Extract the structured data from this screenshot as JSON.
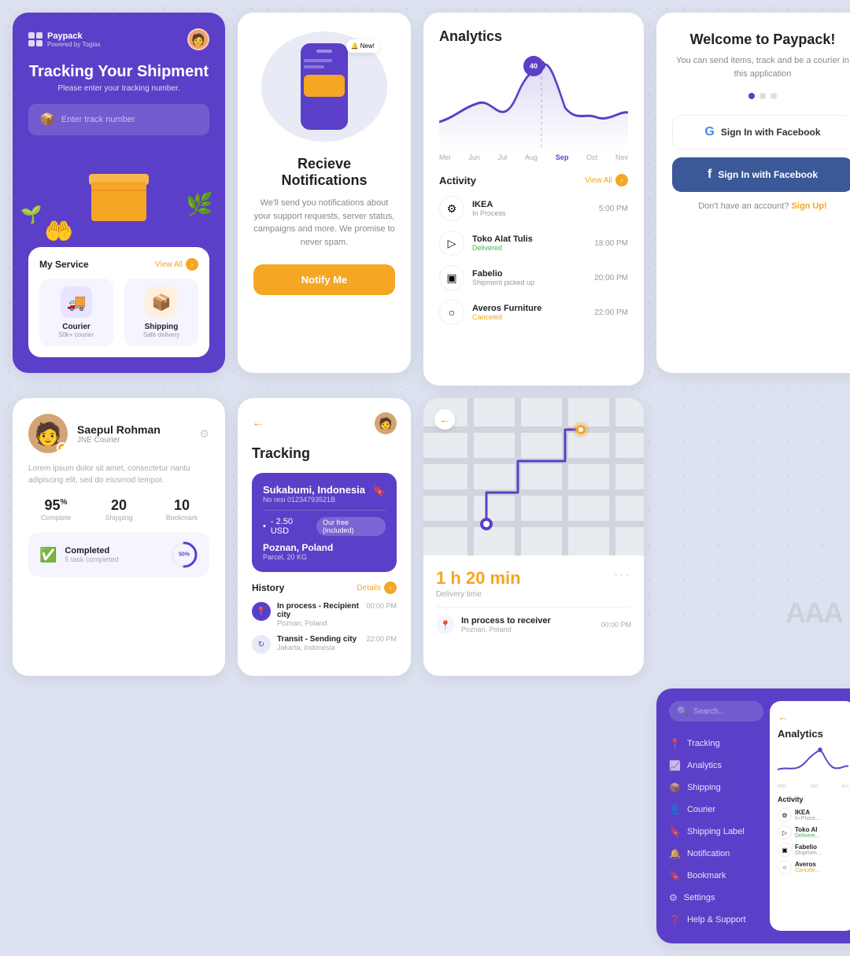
{
  "app": {
    "brand": "Paypack",
    "powered_by": "Powered by Togias"
  },
  "card_tracking": {
    "title": "Tracking Your Shipment",
    "subtitle": "Please enter your tracking number.",
    "input_placeholder": "Enter track number",
    "my_service_title": "My Service",
    "view_all": "View All",
    "service_courier_label": "Courier",
    "service_courier_sub": "50k+ courier",
    "service_shipping_label": "Shipping",
    "service_shipping_sub": "Safe delivery"
  },
  "card_notifications": {
    "title": "Recieve Notifications",
    "body": "We'll send you notifications about your support requests, server status, campaigns and more. We promise to never spam.",
    "button": "Notify Me"
  },
  "card_analytics": {
    "title": "Analytics",
    "chart_labels": [
      "Mei",
      "Jun",
      "Jul",
      "Aug",
      "Sep",
      "Oct",
      "Nov"
    ],
    "active_label": "Sep",
    "chart_peak": "40",
    "activity_title": "Activity",
    "view_all": "View All",
    "activities": [
      {
        "name": "IKEA",
        "status": "In Process",
        "status_class": "process",
        "time": "5:00 PM",
        "icon": "⚙"
      },
      {
        "name": "Toko Alat Tulis",
        "status": "Delivered",
        "status_class": "delivered",
        "time": "18:00 PM",
        "icon": "▷"
      },
      {
        "name": "Fabelio",
        "status": "Shipment picked up",
        "status_class": "pickup",
        "time": "20:00 PM",
        "icon": "▣"
      },
      {
        "name": "Averos Furniture",
        "status": "Canceled",
        "status_class": "canceled",
        "time": "22:00 PM",
        "icon": "○"
      }
    ]
  },
  "card_welcome": {
    "title": "Welcome to Paypack!",
    "body": "You can send items, track and be a courier in this application",
    "btn_google": "Sign In with Facebook",
    "btn_facebook": "Sign In with Facebook",
    "no_account": "Don't have an account?",
    "sign_up": "Sign Up!"
  },
  "card_profile": {
    "name": "Saepul Rohman",
    "sub": "JNE Courier",
    "desc": "Lorem ipsum dolor sit amet, consectetur nantu adipiscing elit, sed do eiusmod tempor.",
    "stat_complete_val": "95",
    "stat_complete_sup": "%",
    "stat_complete_label": "Complete",
    "stat_shipping_val": "20",
    "stat_shipping_label": "Shipping",
    "stat_bookmark_val": "10",
    "stat_bookmark_label": "Bookmark",
    "completed_label": "Completed",
    "completed_sub": "5 task completed",
    "progress_val": "50%"
  },
  "card_tracking_detail": {
    "title": "Tracking",
    "origin_city": "Sukabumi, Indonesia",
    "tracking_no": "No resi 01234793521B",
    "amount": "- 2.50 USD",
    "free_label": "Our free (included)",
    "dest_city": "Poznan, Poland",
    "dest_sub": "Parcel, 20 KG",
    "history_title": "History",
    "details": "Details",
    "history_items": [
      {
        "label": "In process - Recipient city",
        "city": "Poznan, Poland",
        "time": "00:00 PM"
      },
      {
        "label": "Transit - Sending city",
        "city": "Jakarta, Indonesia",
        "time": "22:00 PM"
      }
    ]
  },
  "card_map": {
    "delivery_time": "1 h 20 min",
    "delivery_label": "Delivery time",
    "in_process": "In process to receiver",
    "city": "Poznan, Poland",
    "time": "00:00 PM"
  },
  "sidebar": {
    "search_placeholder": "Search...",
    "menu_items": [
      {
        "label": "Tracking",
        "icon": "📍"
      },
      {
        "label": "Analytics",
        "icon": "📈"
      },
      {
        "label": "Shipping",
        "icon": "📦"
      },
      {
        "label": "Courier",
        "icon": "👤"
      },
      {
        "label": "Shipping Label",
        "icon": "🔖"
      },
      {
        "label": "Notification",
        "icon": "🔔"
      },
      {
        "label": "Bookmark",
        "icon": "🔖"
      },
      {
        "label": "Settings",
        "icon": "⚙"
      },
      {
        "label": "Help & Support",
        "icon": "❓"
      }
    ],
    "right_panel_title": "Analytics",
    "chart_labels": [
      "Mei",
      "Jan",
      "Au"
    ],
    "activity_title": "Activity",
    "mini_activities": [
      {
        "name": "IKEA",
        "status": "In Proce...",
        "status_class": "process"
      },
      {
        "name": "Toko Al",
        "status": "Delivere...",
        "status_class": "delivered"
      },
      {
        "name": "Fabelio",
        "status": "Shipmen...",
        "status_class": "pickup"
      },
      {
        "name": "Averos",
        "status": "Cancele...",
        "status_class": "canceled"
      }
    ]
  }
}
